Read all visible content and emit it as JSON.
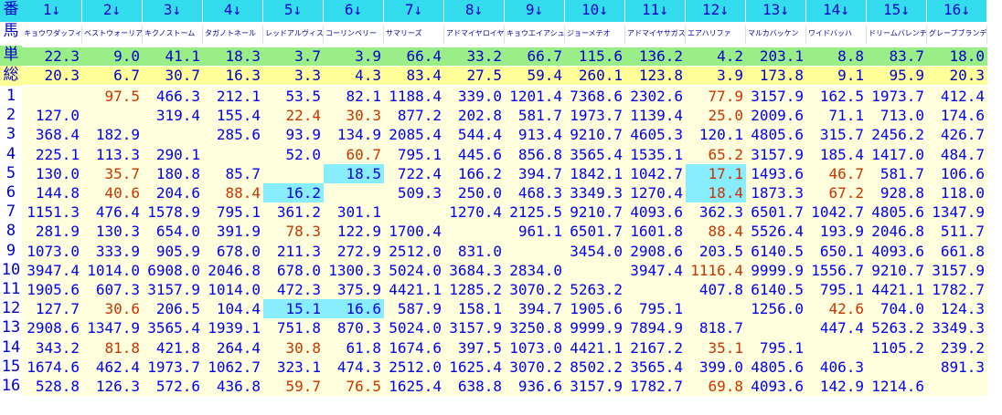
{
  "labels": {
    "ban": "番",
    "uma": "馬",
    "tan": "単",
    "sou": "総"
  },
  "horse_numbers": [
    "1↓",
    "2↓",
    "3↓",
    "4↓",
    "5↓",
    "6↓",
    "7↓",
    "8↓",
    "9↓",
    "10↓",
    "11↓",
    "12↓",
    "13↓",
    "14↓",
    "15↓",
    "16↓"
  ],
  "horse_names": [
    "キョウワダッフィ",
    "ベストウォーリア",
    "キクノストーム",
    "タガノトネール",
    "レッドアルヴィス",
    "コーリンベリー",
    "サマリーズ",
    "アドマイヤロイヤ",
    "キョウエイアシュ",
    "ジョーメテオ",
    "アドマイヤサガス",
    "エアハリファ",
    "マルカバッケン",
    "ワイドバッハ",
    "ドリームバレンチ",
    "グレープブランデ"
  ],
  "win_odds": [
    "22.3",
    "9.0",
    "41.1",
    "18.3",
    "3.7",
    "3.9",
    "66.4",
    "33.2",
    "66.7",
    "115.6",
    "136.2",
    "4.2",
    "203.1",
    "8.8",
    "83.7",
    "18.0"
  ],
  "place_odds": [
    "20.3",
    "6.7",
    "30.7",
    "16.3",
    "3.3",
    "4.3",
    "83.4",
    "27.5",
    "59.4",
    "260.1",
    "123.8",
    "3.9",
    "173.8",
    "9.1",
    "95.9",
    "20.3"
  ],
  "row_labels": [
    "1",
    "2",
    "3",
    "4",
    "5",
    "6",
    "7",
    "8",
    "9",
    "10",
    "11",
    "12",
    "13",
    "14",
    "15",
    "16"
  ],
  "quinella": [
    [
      "",
      "97.5",
      "466.3",
      "212.1",
      "53.5",
      "82.1",
      "1188.4",
      "339.0",
      "1201.4",
      "7368.6",
      "2302.6",
      "77.9",
      "3157.9",
      "162.5",
      "1973.7",
      "412.4"
    ],
    [
      "127.0",
      "",
      "319.4",
      "155.4",
      "22.4",
      "30.3",
      "877.2",
      "202.8",
      "581.7",
      "1973.7",
      "1139.4",
      "25.0",
      "2009.6",
      "71.1",
      "713.0",
      "174.6"
    ],
    [
      "368.4",
      "182.9",
      "",
      "285.6",
      "93.9",
      "134.9",
      "2085.4",
      "544.4",
      "913.4",
      "9210.7",
      "4605.3",
      "120.1",
      "4805.6",
      "315.7",
      "2456.2",
      "426.7"
    ],
    [
      "225.1",
      "113.3",
      "290.1",
      "",
      "52.0",
      "60.7",
      "795.1",
      "445.6",
      "856.8",
      "3565.4",
      "1535.1",
      "65.2",
      "3157.9",
      "185.4",
      "1417.0",
      "484.7"
    ],
    [
      "130.0",
      "35.7",
      "180.8",
      "85.7",
      "",
      "18.5",
      "722.4",
      "166.2",
      "394.7",
      "1842.1",
      "1042.7",
      "17.1",
      "1493.6",
      "46.7",
      "581.7",
      "106.6"
    ],
    [
      "144.8",
      "40.6",
      "204.6",
      "88.4",
      "16.2",
      "",
      "509.3",
      "250.0",
      "468.3",
      "3349.3",
      "1270.4",
      "18.4",
      "1873.3",
      "67.2",
      "928.8",
      "118.0"
    ],
    [
      "1151.3",
      "476.4",
      "1578.9",
      "795.1",
      "361.2",
      "301.1",
      "",
      "1270.4",
      "2125.5",
      "9210.7",
      "4093.6",
      "362.3",
      "6501.7",
      "1042.7",
      "4805.6",
      "1347.9"
    ],
    [
      "281.9",
      "130.3",
      "654.0",
      "391.9",
      "78.3",
      "122.9",
      "1700.4",
      "",
      "961.1",
      "6501.7",
      "1601.8",
      "88.4",
      "5526.4",
      "193.9",
      "2046.8",
      "511.7"
    ],
    [
      "1073.0",
      "333.9",
      "905.9",
      "678.0",
      "211.3",
      "272.9",
      "2512.0",
      "831.0",
      "",
      "3454.0",
      "2908.6",
      "203.5",
      "6140.5",
      "650.1",
      "4093.6",
      "661.8"
    ],
    [
      "3947.4",
      "1014.0",
      "6908.0",
      "2046.8",
      "678.0",
      "1300.3",
      "5024.0",
      "3684.3",
      "2834.0",
      "",
      "3947.4",
      "1116.4",
      "9999.9",
      "1556.7",
      "9210.7",
      "3157.9"
    ],
    [
      "1905.6",
      "607.3",
      "3157.9",
      "1014.0",
      "472.3",
      "375.9",
      "4421.1",
      "1285.2",
      "3070.2",
      "5263.2",
      "",
      "407.8",
      "6140.5",
      "795.1",
      "4421.1",
      "1782.7"
    ],
    [
      "127.7",
      "30.6",
      "206.5",
      "104.4",
      "15.1",
      "16.6",
      "587.9",
      "158.1",
      "394.7",
      "1905.6",
      "795.1",
      "",
      "1256.0",
      "42.6",
      "704.0",
      "124.3"
    ],
    [
      "2908.6",
      "1347.9",
      "3565.4",
      "1939.1",
      "751.8",
      "870.3",
      "5024.0",
      "3157.9",
      "3250.8",
      "9999.9",
      "7894.9",
      "818.7",
      "",
      "447.4",
      "5263.2",
      "3349.3"
    ],
    [
      "343.2",
      "81.8",
      "421.8",
      "264.4",
      "30.8",
      "61.8",
      "1674.6",
      "397.5",
      "1073.0",
      "4421.1",
      "2167.2",
      "35.1",
      "795.1",
      "",
      "1105.2",
      "239.2"
    ],
    [
      "1674.6",
      "462.4",
      "1973.7",
      "1062.7",
      "323.1",
      "474.3",
      "2512.0",
      "1625.4",
      "3070.2",
      "8502.2",
      "3565.4",
      "399.0",
      "4805.6",
      "406.3",
      "",
      "891.3"
    ],
    [
      "528.8",
      "126.3",
      "572.6",
      "436.8",
      "59.7",
      "76.5",
      "1625.4",
      "638.8",
      "936.6",
      "3157.9",
      "1782.7",
      "69.8",
      "4093.6",
      "142.9",
      "1214.6",
      ""
    ]
  ],
  "red_cells": [
    [
      1,
      2
    ],
    [
      1,
      12
    ],
    [
      2,
      5
    ],
    [
      2,
      6
    ],
    [
      2,
      12
    ],
    [
      4,
      6
    ],
    [
      4,
      12
    ],
    [
      5,
      2
    ],
    [
      5,
      12
    ],
    [
      5,
      14
    ],
    [
      6,
      2
    ],
    [
      6,
      4
    ],
    [
      6,
      12
    ],
    [
      6,
      14
    ],
    [
      8,
      5
    ],
    [
      8,
      12
    ],
    [
      10,
      12
    ],
    [
      12,
      2
    ],
    [
      12,
      14
    ],
    [
      14,
      2
    ],
    [
      14,
      5
    ],
    [
      14,
      12
    ],
    [
      16,
      5
    ],
    [
      16,
      6
    ],
    [
      16,
      12
    ]
  ],
  "cyan_cells": [
    [
      5,
      6
    ],
    [
      5,
      12
    ],
    [
      6,
      5
    ],
    [
      6,
      12
    ],
    [
      12,
      5
    ],
    [
      12,
      6
    ]
  ],
  "colors": {
    "header_cyan": "#33ddee",
    "win_green": "#99ee88",
    "place_yellow": "#ffff99",
    "grid_cream": "#ffffdd",
    "highlight_cyan": "#88eeff",
    "text_blue": "#0000ee",
    "text_red": "#cc3300"
  }
}
